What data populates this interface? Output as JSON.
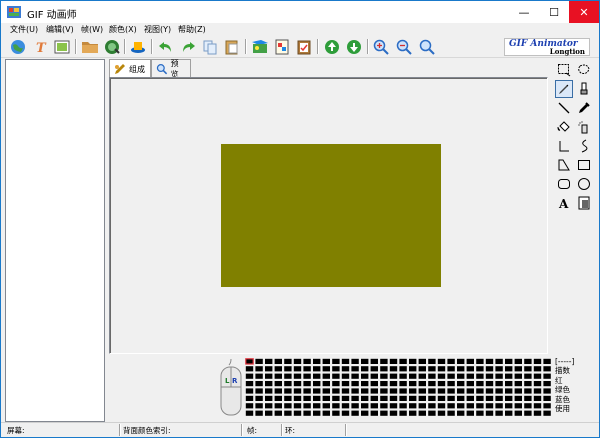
{
  "window": {
    "title": "GIF 动画师",
    "min_glyph": "—",
    "max_glyph": "☐",
    "close_glyph": "✕"
  },
  "menu": [
    {
      "label": "文件(U)"
    },
    {
      "label": "编辑(V)"
    },
    {
      "label": "帧(W)"
    },
    {
      "label": "颜色(X)"
    },
    {
      "label": "视图(Y)"
    },
    {
      "label": "帮助(Z)"
    }
  ],
  "brand": {
    "title": "GIF Animator",
    "subtitle": "Longtion"
  },
  "tabs": [
    {
      "label": "组成"
    },
    {
      "label": "预览"
    }
  ],
  "legend": {
    "line1": "[-----]",
    "line2": "描数",
    "line3": "红",
    "line4": "绿色",
    "line5": "蓝色",
    "line6": "使用"
  },
  "mouse": {
    "left": "L",
    "right": "R"
  },
  "status": {
    "screen": "屏幕:",
    "bg_index": "背面颜色索引:",
    "frame": "帧:",
    "loop": "环:"
  },
  "colors": {
    "canvas_fill": "#808000",
    "accent": "#1979ca",
    "close": "#e81123"
  }
}
